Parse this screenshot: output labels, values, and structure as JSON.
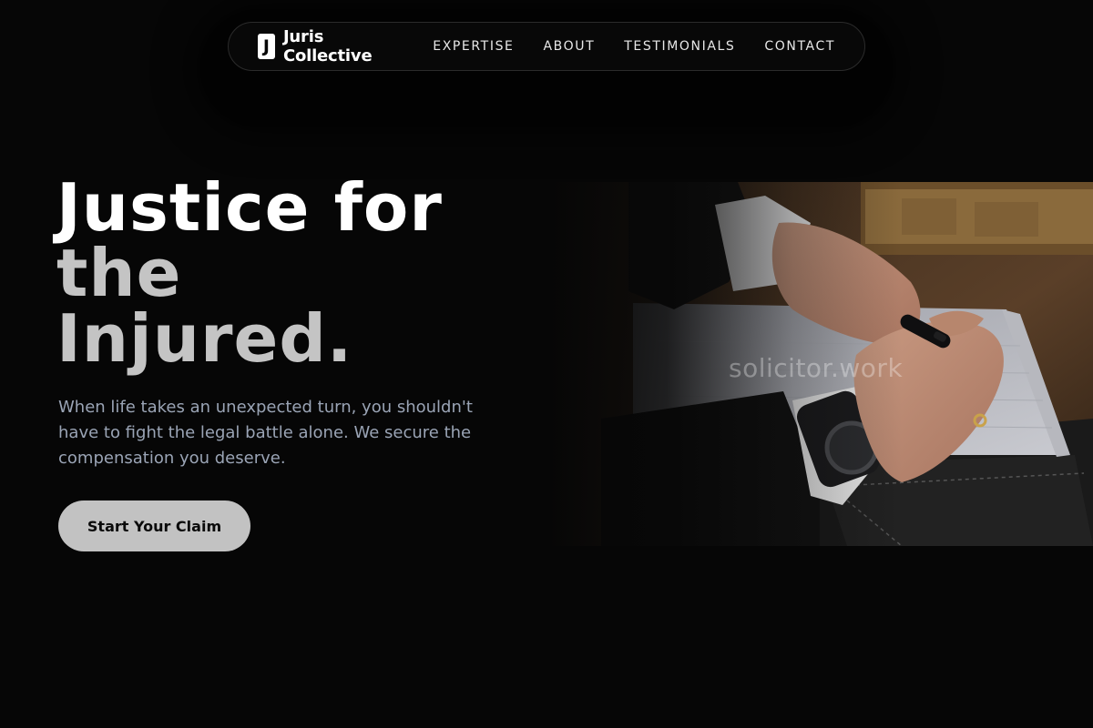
{
  "nav": {
    "brand_mark": "J",
    "brand_name": "Juris Collective",
    "links": [
      "EXPERTISE",
      "ABOUT",
      "TESTIMONIALS",
      "CONTACT"
    ]
  },
  "hero": {
    "title_line1": "Justice for",
    "title_line2": "the",
    "title_line3": "Injured.",
    "subtitle": "When life takes an unexpected turn, you shouldn't have to fight the legal battle alone. We secure the compensation you deserve.",
    "cta_label": "Start Your Claim",
    "image": {
      "alt": "Hands of a lawyer in a suit signing a document with a pen",
      "watermark": "solicitor.work"
    }
  },
  "colors": {
    "background": "#060606",
    "title_primary": "#ffffff",
    "title_muted": "#c4c4c4",
    "subtitle": "#9aa4b5",
    "cta_bg": "#c2c2c2"
  }
}
